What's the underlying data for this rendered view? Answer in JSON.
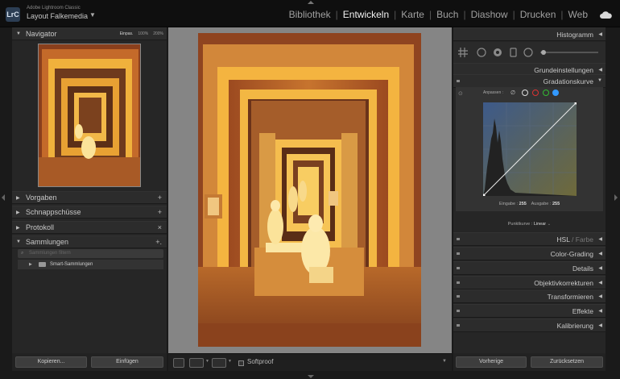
{
  "app": {
    "badge": "LrC",
    "name": "Adobe Lightroom Classic",
    "catalog": "Layout Falkemedia"
  },
  "modules": [
    {
      "label": "Bibliothek",
      "active": false
    },
    {
      "label": "Entwickeln",
      "active": true
    },
    {
      "label": "Karte",
      "active": false
    },
    {
      "label": "Buch",
      "active": false
    },
    {
      "label": "Diashow",
      "active": false
    },
    {
      "label": "Drucken",
      "active": false
    },
    {
      "label": "Web",
      "active": false
    }
  ],
  "left_panel": {
    "navigator": {
      "label": "Navigator",
      "zoom_options": [
        "Einpas.",
        "100%",
        "200%"
      ]
    },
    "presets": {
      "label": "Vorgaben",
      "action": "+"
    },
    "snapshots": {
      "label": "Schnappschüsse",
      "action": "+"
    },
    "history": {
      "label": "Protokoll",
      "action": "×"
    },
    "collections": {
      "label": "Sammlungen",
      "action": "+.",
      "search_placeholder": "Sammlungen filtern",
      "smart_collections": "Smart-Sammlungen"
    },
    "copy_button": "Kopieren...",
    "paste_button": "Einfügen"
  },
  "toolbar": {
    "softproof": "Softproof"
  },
  "right_panel": {
    "histogram": "Histogramm",
    "basic": "Grundeinstellungen",
    "tone_curve": {
      "label": "Gradationskurve",
      "adjust": "Anpassen :",
      "input_label": "Eingabe :",
      "input_value": "255",
      "output_label": "Ausgabe :",
      "output_value": "255",
      "point_curve_label": "Punktkurve :",
      "point_curve_value": "Linear"
    },
    "hsl": "HSL",
    "color": "Farbe",
    "color_grading": "Color-Grading",
    "detail": "Details",
    "lens": "Objektivkorrekturen",
    "transform": "Transformieren",
    "effects": "Effekte",
    "calibration": "Kalibrierung",
    "previous_button": "Vorherige",
    "reset_button": "Zurücksetzen"
  },
  "colors": {
    "accent": "#39f",
    "photo_light": "#f5b940",
    "photo_dark": "#8a3f1c"
  }
}
